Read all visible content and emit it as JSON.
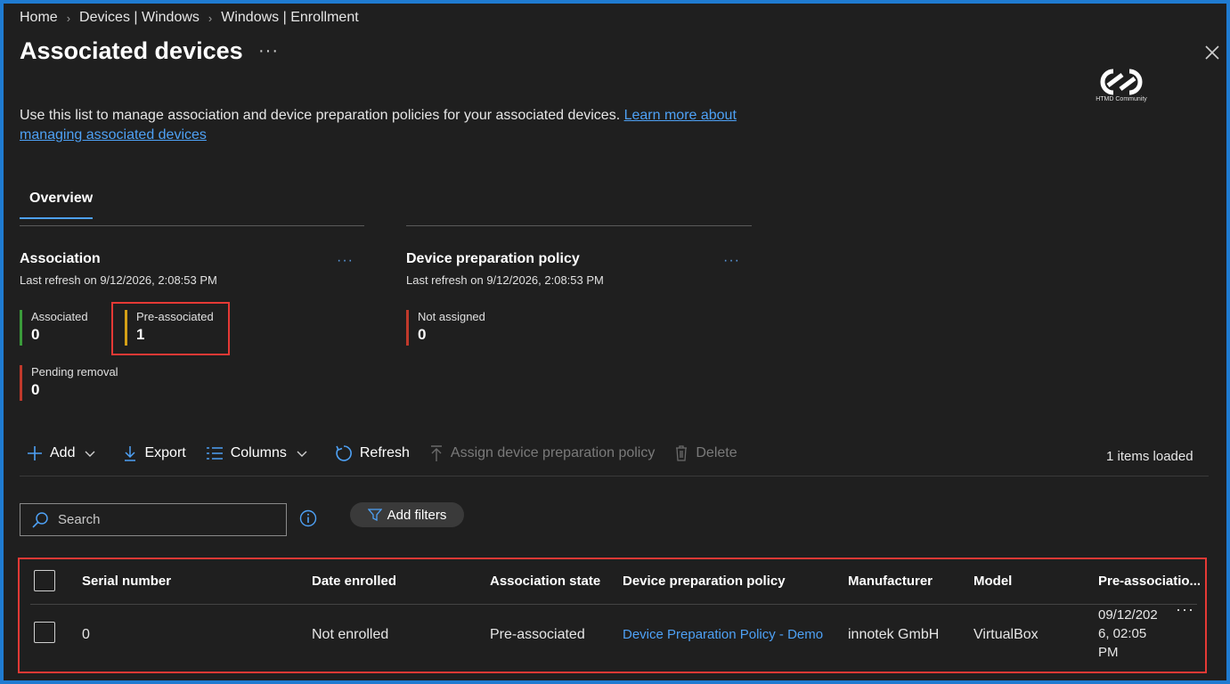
{
  "breadcrumb": [
    "Home",
    "Devices | Windows",
    "Windows | Enrollment"
  ],
  "page": {
    "title": "Associated devices",
    "more": "···"
  },
  "logo": {
    "text": "HTMD Community"
  },
  "description": {
    "text": "Use this list to manage association and device preparation policies for your associated devices.",
    "link_text": "Learn more about managing associated devices"
  },
  "tabs": [
    {
      "label": "Overview",
      "selected": true
    }
  ],
  "cards": {
    "association": {
      "title": "Association",
      "last_refresh": "Last refresh on 9/12/2026, 2:08:53 PM",
      "more": "···",
      "metrics": [
        {
          "label": "Associated",
          "value": "0",
          "color": "#3a9b3a"
        },
        {
          "label": "Pre-associated",
          "value": "1",
          "color": "#d4a017"
        },
        {
          "label": "Pending removal",
          "value": "0",
          "color": "#c0392b"
        }
      ]
    },
    "prep_policy": {
      "title": "Device preparation policy",
      "last_refresh": "Last refresh on 9/12/2026, 2:08:53 PM",
      "more": "···",
      "metrics": [
        {
          "label": "Not assigned",
          "value": "0",
          "color": "#c0392b"
        }
      ]
    }
  },
  "toolbar": {
    "add": "Add",
    "export": "Export",
    "columns": "Columns",
    "refresh": "Refresh",
    "assign": "Assign device preparation policy",
    "delete": "Delete",
    "items_loaded": "1 items loaded"
  },
  "search": {
    "placeholder": "Search"
  },
  "filters": {
    "label": "Add filters"
  },
  "table": {
    "columns": [
      "Serial number",
      "Date enrolled",
      "Association state",
      "Device preparation policy",
      "Manufacturer",
      "Model",
      "Pre-associatio..."
    ],
    "rows": [
      {
        "serial": "0",
        "date_enrolled": "Not enrolled",
        "state": "Pre-associated",
        "policy": "Device Preparation Policy - Demo",
        "manufacturer": "innotek GmbH",
        "model": "VirtualBox",
        "pre_assoc_l1": "09/12/202",
        "pre_assoc_l2": "6, 02:05",
        "pre_assoc_l3": "PM",
        "more": "···"
      }
    ]
  },
  "colors": {
    "accent": "#4ea1f5",
    "highlight": "#e53935",
    "background": "#1f1f1f"
  }
}
